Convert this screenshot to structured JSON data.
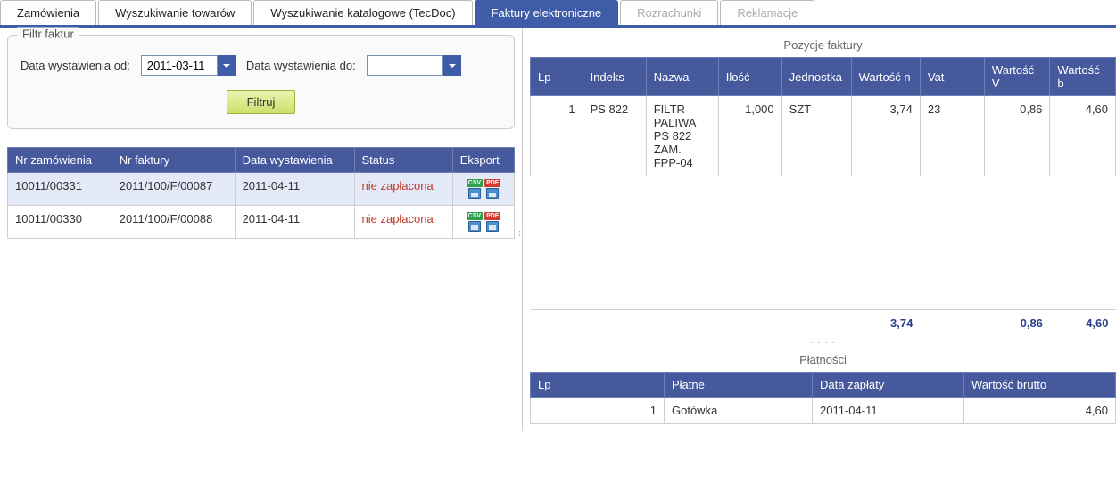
{
  "tabs": [
    {
      "label": "Zamówienia",
      "active": false,
      "disabled": false
    },
    {
      "label": "Wyszukiwanie towarów",
      "active": false,
      "disabled": false
    },
    {
      "label": "Wyszukiwanie katalogowe (TecDoc)",
      "active": false,
      "disabled": false
    },
    {
      "label": "Faktury elektroniczne",
      "active": true,
      "disabled": false
    },
    {
      "label": "Rozrachunki",
      "active": false,
      "disabled": true
    },
    {
      "label": "Reklamacje",
      "active": false,
      "disabled": true
    }
  ],
  "filter": {
    "panel_title": "Filtr faktur",
    "date_from_label": "Data wystawienia od:",
    "date_from_value": "2011-03-11",
    "date_to_label": "Data wystawienia do:",
    "date_to_value": "",
    "button_label": "Filtruj"
  },
  "invoice_table": {
    "headers": {
      "order_no": "Nr zamówienia",
      "invoice_no": "Nr faktury",
      "issue_date": "Data wystawienia",
      "status": "Status",
      "export": "Eksport"
    },
    "rows": [
      {
        "order_no": "10011/00331",
        "invoice_no": "2011/100/F/00087",
        "issue_date": "2011-04-11",
        "status": "nie zapłacona",
        "selected": true
      },
      {
        "order_no": "10011/00330",
        "invoice_no": "2011/100/F/00088",
        "issue_date": "2011-04-11",
        "status": "nie zapłacona",
        "selected": false
      }
    ]
  },
  "line_items": {
    "section_title": "Pozycje faktury",
    "headers": {
      "lp": "Lp",
      "index": "Indeks",
      "name": "Nazwa",
      "qty": "Ilość",
      "unit": "Jednostka",
      "net": "Wartość n",
      "vat": "Vat",
      "vat_val": "Wartość V",
      "gross": "Wartość b"
    },
    "rows": [
      {
        "lp": "1",
        "index": "PS 822",
        "name": "FILTR PALIWA PS 822 ZAM. FPP-04",
        "qty": "1,000",
        "unit": "SZT",
        "net": "3,74",
        "vat": "23",
        "vat_val": "0,86",
        "gross": "4,60"
      }
    ],
    "totals": {
      "net": "3,74",
      "vat_val": "0,86",
      "gross": "4,60"
    }
  },
  "payments": {
    "section_title": "Płatności",
    "headers": {
      "lp": "Lp",
      "payable": "Płatne",
      "pay_date": "Data zapłaty",
      "gross": "Wartość brutto"
    },
    "rows": [
      {
        "lp": "1",
        "payable": "Gotówka",
        "pay_date": "2011-04-11",
        "gross": "4,60"
      }
    ]
  },
  "icons": {
    "csv": "CSV",
    "pdf": "PDF"
  }
}
